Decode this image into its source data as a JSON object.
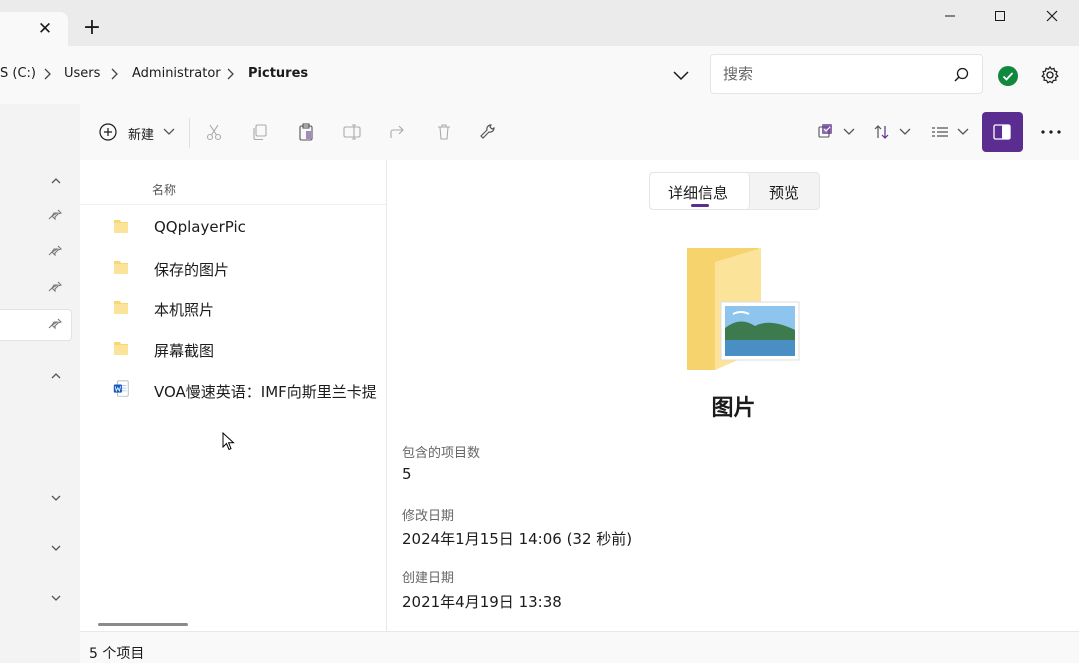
{
  "window": {
    "tab_close": "✕",
    "new_tab": "+"
  },
  "address": {
    "crumbs": [
      "S (C:)",
      "Users",
      "Administrator",
      "Pictures"
    ],
    "search_placeholder": "搜索"
  },
  "toolbar": {
    "new_label": "新建"
  },
  "file_list": {
    "column_name": "名称",
    "items": [
      {
        "name": "QQplayerPic",
        "icon": "folder-icon"
      },
      {
        "name": "保存的图片",
        "icon": "folder-icon"
      },
      {
        "name": "本机照片",
        "icon": "folder-icon"
      },
      {
        "name": "屏幕截图",
        "icon": "folder-icon"
      },
      {
        "name": "VOA慢速英语：IMF向斯里兰卡提",
        "icon": "word-document-icon"
      }
    ]
  },
  "details": {
    "tab_details": "详细信息",
    "tab_preview": "预览",
    "title": "图片",
    "items_count_label": "包含的项目数",
    "items_count_value": "5",
    "modified_label": "修改日期",
    "modified_value": "2024年1月15日 14:06 (32 秒前)",
    "created_label": "创建日期",
    "created_value": "2021年4月19日 13:38"
  },
  "status": {
    "count_text": "5 个项目"
  },
  "colors": {
    "accent": "#5c2d91",
    "sync_ok": "#10893e",
    "folder": "#f8d775"
  }
}
